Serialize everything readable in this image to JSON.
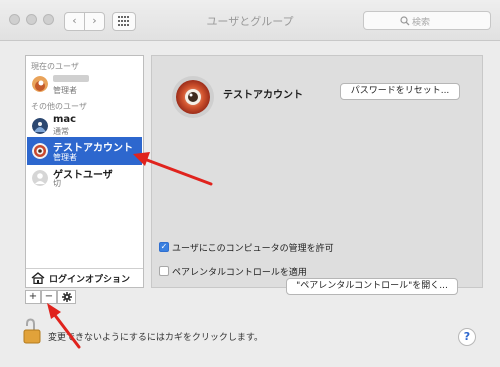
{
  "window": {
    "title": "ユーザとグループ",
    "nav_back": "‹",
    "nav_forward": "›",
    "search_placeholder": "検索"
  },
  "sidebar": {
    "current_section": "現在のユーザ",
    "current_user": {
      "name": "",
      "role": "管理者"
    },
    "other_section": "その他のユーザ",
    "users": [
      {
        "name": "mac",
        "role": "通常"
      },
      {
        "name": "テストアカウント",
        "role": "管理者",
        "selected": true
      },
      {
        "name": "ゲストユーザ",
        "role": "切"
      }
    ],
    "login_options": "ログインオプション",
    "add": "+",
    "remove": "−",
    "gear": "✲"
  },
  "detail": {
    "account_name": "テストアカウント",
    "reset_password": "パスワードをリセット...",
    "allow_admin": "ユーザにこのコンピュータの管理を許可",
    "allow_admin_checked": true,
    "parental": "ペアレンタルコントロールを適用",
    "parental_checked": false,
    "open_parental": "\"ペアレンタルコントロール\"を開く..."
  },
  "footer": {
    "lock_text": "変更できないようにするにはカギをクリックします。",
    "help": "?"
  },
  "colors": {
    "selection": "#2d67ce",
    "annotation_arrow": "#e0231d"
  }
}
